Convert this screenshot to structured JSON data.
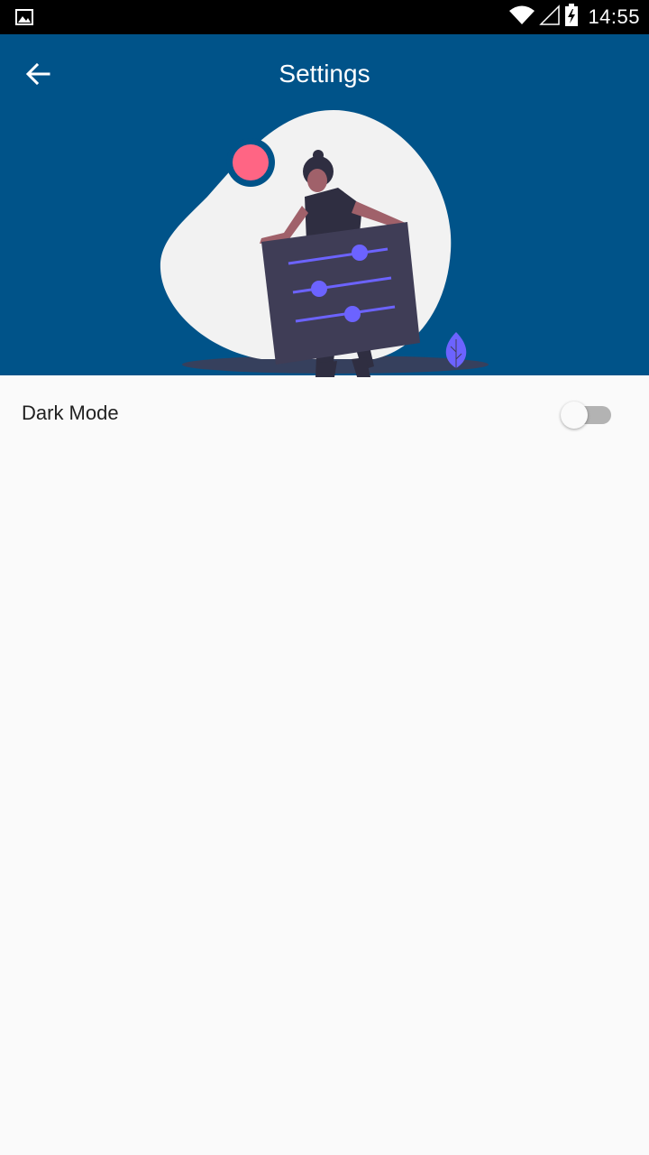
{
  "status_bar": {
    "time": "14:55",
    "left_icon": "image-icon",
    "icons": [
      "wifi-icon",
      "signal-icon",
      "battery-charging-icon"
    ]
  },
  "header": {
    "title": "Settings",
    "back_icon": "arrow-back-icon",
    "background_color": "#005389",
    "illustration": "settings-illustration"
  },
  "settings": {
    "items": [
      {
        "label": "Dark Mode",
        "type": "toggle",
        "enabled": false
      }
    ]
  },
  "colors": {
    "accent": "#005389",
    "illustration_purple": "#6c63ff",
    "illustration_pink": "#ff6584",
    "toggle_track_off": "#b3b3b3"
  }
}
